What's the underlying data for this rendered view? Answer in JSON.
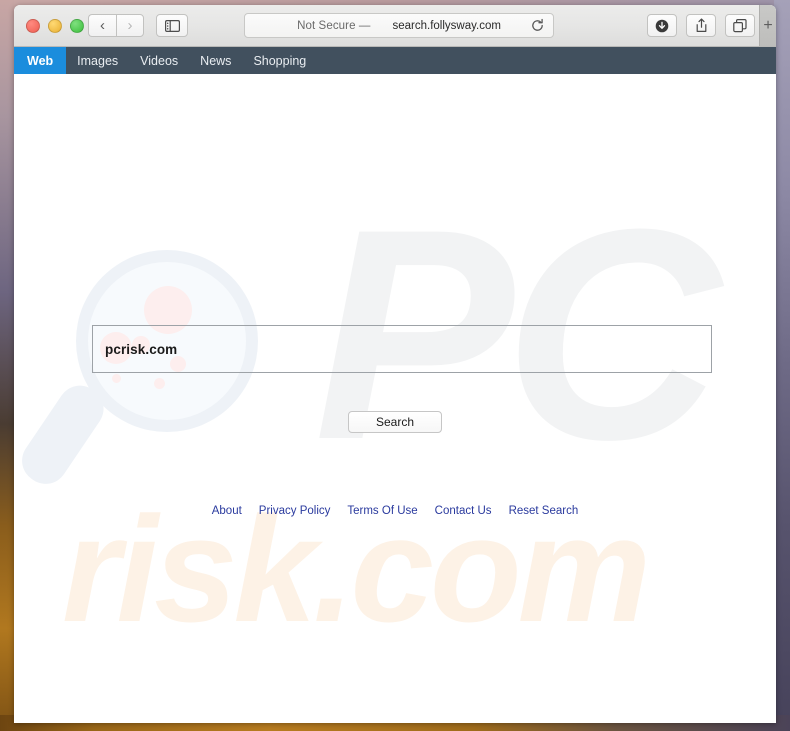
{
  "desktop": {
    "label": "desktop-wallpaper"
  },
  "browser": {
    "window_controls": [
      {
        "name": "close",
        "color": "#ee5f52"
      },
      {
        "name": "minimize",
        "color": "#e9b032"
      },
      {
        "name": "zoom",
        "color": "#3cbf3c"
      }
    ],
    "nav": {
      "back_icon": "chevron-left-icon",
      "back_glyph": "‹",
      "forward_icon": "chevron-right-icon",
      "forward_glyph": "›",
      "sidebar_icon": "sidebar-toggle-icon"
    },
    "address_bar": {
      "security_label": "Not Secure —",
      "url": "search.follysway.com",
      "reload_icon": "reload-icon"
    },
    "toolbar_right": [
      {
        "icon": "downloads-icon",
        "name": "downloads-button"
      },
      {
        "icon": "share-icon",
        "name": "share-button"
      },
      {
        "icon": "tab-overview-icon",
        "name": "show-tabs-button"
      }
    ],
    "new_tab_label": "+"
  },
  "site_nav": {
    "active_index": 0,
    "active_color": "#1b8ddd",
    "bar_color": "#41505e",
    "items": [
      {
        "label": "Web"
      },
      {
        "label": "Images"
      },
      {
        "label": "Videos"
      },
      {
        "label": "News"
      },
      {
        "label": "Shopping"
      }
    ]
  },
  "page": {
    "watermark_pc": "PC",
    "watermark_risk": "risk.com",
    "watermark_glass_icon": "magnifier-watermark-icon",
    "search": {
      "query": "pcrisk.com",
      "placeholder": "",
      "button_label": "Search"
    },
    "footer_links": [
      {
        "label": "About"
      },
      {
        "label": "Privacy Policy"
      },
      {
        "label": "Terms Of Use"
      },
      {
        "label": "Contact Us"
      },
      {
        "label": "Reset Search"
      }
    ],
    "link_color": "#2a3a9e"
  }
}
